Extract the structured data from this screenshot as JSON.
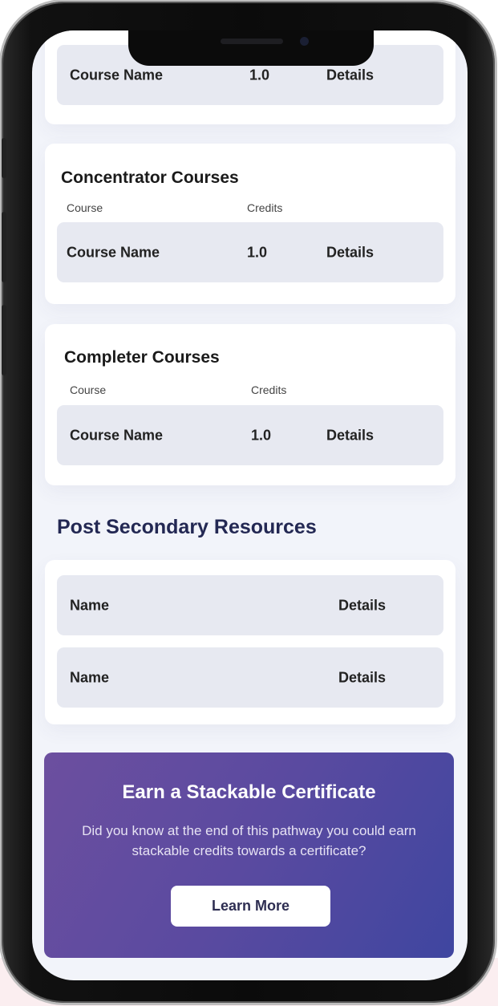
{
  "top_card": {
    "row": {
      "course": "Course Name",
      "credits": "1.0",
      "details": "Details"
    }
  },
  "concentrator": {
    "title": "Concentrator Courses",
    "col_course": "Course",
    "col_credits": "Credits",
    "row": {
      "course": "Course Name",
      "credits": "1.0",
      "details": "Details"
    }
  },
  "completer": {
    "title": "Completer Courses",
    "col_course": "Course",
    "col_credits": "Credits",
    "row": {
      "course": "Course Name",
      "credits": "1.0",
      "details": "Details"
    }
  },
  "post_secondary": {
    "title": "Post Secondary Resources",
    "items": [
      {
        "name": "Name",
        "details": "Details"
      },
      {
        "name": "Name",
        "details": "Details"
      }
    ]
  },
  "promo": {
    "title": "Earn a Stackable Certificate",
    "text": "Did you know at the end of this pathway you could earn stackable credits towards a certificate?",
    "button": "Learn More"
  },
  "colors": {
    "accent_dark": "#232853",
    "promo_gradient_start": "#6c4f9f",
    "promo_gradient_end": "#3f46a0",
    "row_bg": "#e7e9f1",
    "screen_bg": "#f2f4fa"
  }
}
